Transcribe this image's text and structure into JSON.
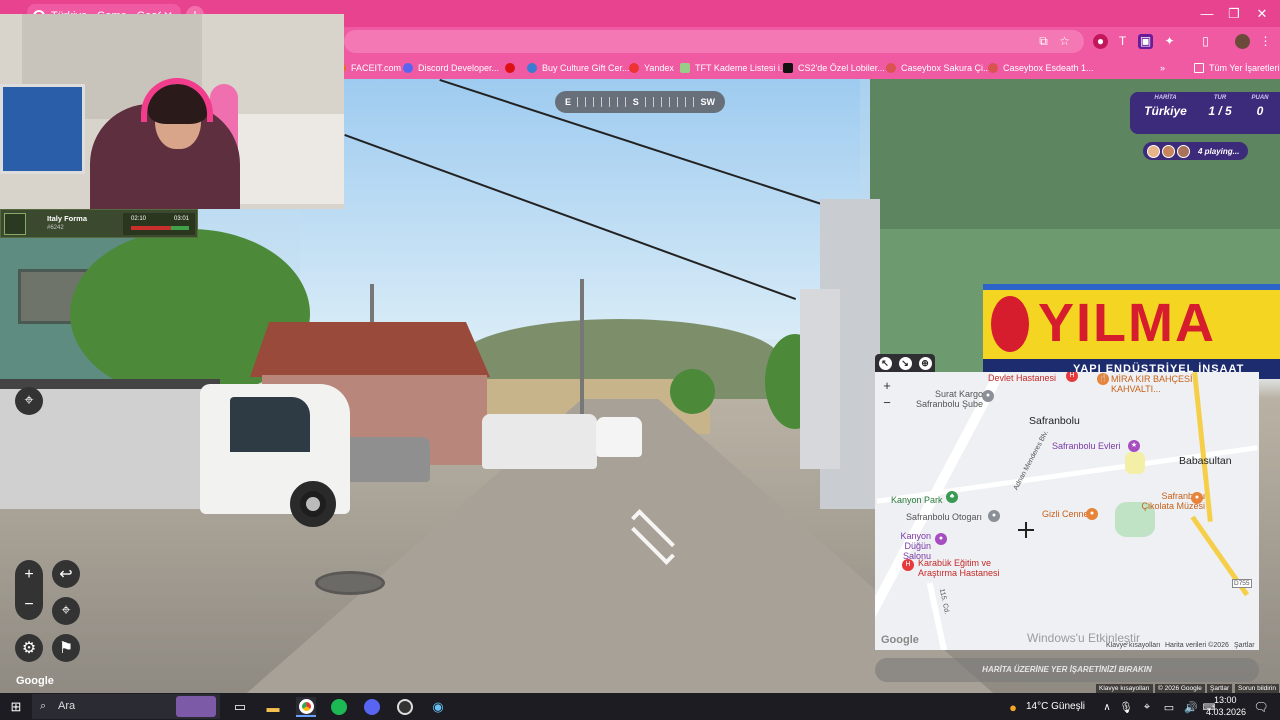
{
  "browser": {
    "tab_title": "Türkiye - Game - GeoGuessr",
    "bookmarks": [
      {
        "label": "FACEIT.com",
        "color": "#f66a1a"
      },
      {
        "label": "Discord Developer...",
        "color": "#5865f2"
      },
      {
        "label": "",
        "color": "#d11"
      },
      {
        "label": "Buy Culture Gift Cer...",
        "color": "#3b7bd3"
      },
      {
        "label": "Yandex",
        "color": "#e33"
      },
      {
        "label": "TFT Kademe Listesi i...",
        "color": "#9c8"
      },
      {
        "label": "CS2'de Özel Lobiler...",
        "color": "#111"
      },
      {
        "label": "Caseybox Sakura Çi...",
        "color": "#d9534f"
      },
      {
        "label": "Caseybox Esdeath 1...",
        "color": "#d9534f"
      }
    ],
    "bookmarks_folder": "Tüm Yer İşaretleri"
  },
  "game": {
    "map_label": "HARİTA",
    "map_value": "Türkiye",
    "round_label": "TUR",
    "round_value": "1 / 5",
    "score_label": "PUAN",
    "score_value": "0",
    "players_text": "4 playing...",
    "compass": {
      "left": "E",
      "center": "S",
      "right": "SW"
    },
    "guess_button": "HARİTA ÜZERİNE YER İŞARETİNİZİ BIRAKIN",
    "google_logo": "Google"
  },
  "sign": {
    "main": "YILMA",
    "sub": "YAPI  ENDÜSTRİYEL  İNŞAAT"
  },
  "map": {
    "labels": {
      "devlet": "Devlet Hastanesi",
      "mirakir": "MİRA KIR BAHÇESİ KAHVALTI...",
      "surat": "Surat Kargo Safranbolu Şube",
      "safranbolu": "Safranbolu",
      "adnan": "Adnan Menderes Blv.",
      "evleri": "Safranbolu Evleri",
      "babasultan": "Babasultan",
      "cikolata": "Safranbolu Çikolata Müzesi",
      "kanyon_park": "Kanyon Park",
      "gizli": "Gizli Cennet",
      "otogar": "Safranbolu Otogarı",
      "dugun": "Kanyon Düğün Salonu",
      "karabuk": "Karabük Eğitim ve Araştırma Hastanesi",
      "cd115": "115. Cd.",
      "d755": "D755",
      "google": "Google"
    },
    "footer": {
      "shortcuts": "Klavye kısayolları",
      "data": "Harita verileri ©2026",
      "terms": "Şartlar"
    },
    "watermark": "Windows'u Etkinleştir"
  },
  "sv_footer": {
    "shortcuts": "Klavye kısayolları",
    "copyright": "© 2026 Google",
    "terms": "Şartlar",
    "report": "Sorun bildirin"
  },
  "overlay": {
    "faceit_name": "Italy Forma",
    "faceit_sub": "#6242",
    "faceit_score_left": "02:10",
    "faceit_score_right": "03:01"
  },
  "taskbar": {
    "search_placeholder": "Ara",
    "weather": "14°C  Güneşli",
    "time": "13:00",
    "date": "4.03.2026"
  }
}
